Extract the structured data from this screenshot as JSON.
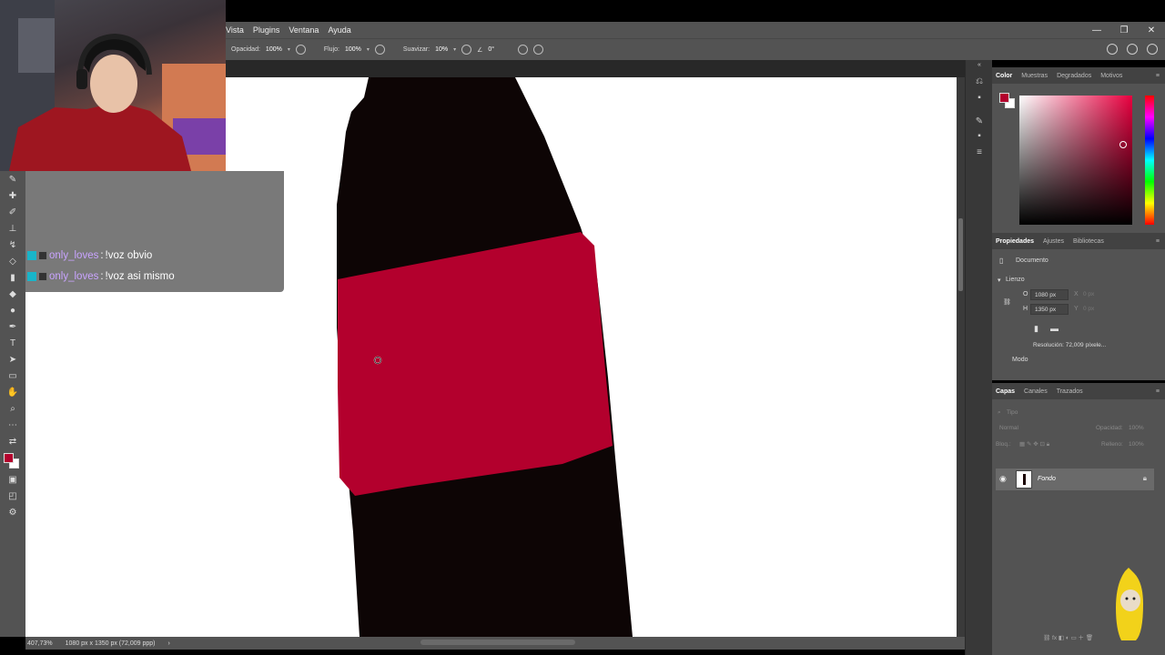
{
  "menu": {
    "items": [
      "Vista",
      "Plugins",
      "Ventana",
      "Ayuda"
    ]
  },
  "options": {
    "opacity_label": "Opacidad:",
    "opacity_value": "100%",
    "flow_label": "Flujo:",
    "flow_value": "100%",
    "smooth_label": "Suavizar:",
    "smooth_value": "10%",
    "angle_value": "0°"
  },
  "status": {
    "zoom": "407,73%",
    "doc_info": "1080 px x 1350 px (72,009 ppp)"
  },
  "color_panel": {
    "tabs": [
      "Color",
      "Muestras",
      "Degradados",
      "Motivos"
    ],
    "foreground": "#b3002d",
    "background": "#ffffff"
  },
  "properties_panel": {
    "tabs": [
      "Propiedades",
      "Ajustes",
      "Bibliotecas"
    ],
    "doc_label": "Documento",
    "section": "Lienzo",
    "width_label": "O",
    "width_value": "1080 px",
    "height_label": "H",
    "height_value": "1350 px",
    "x_label": "X",
    "x_value": "0 px",
    "y_label": "Y",
    "y_value": "0 px",
    "resolution": "Resolución: 72,009 píxele...",
    "mode_label": "Modo"
  },
  "layers_panel": {
    "tabs": [
      "Capas",
      "Canales",
      "Trazados"
    ],
    "search_placeholder": "Tipo",
    "blend_mode": "Normal",
    "opacity_label": "Opacidad:",
    "opacity_value": "100%",
    "lock_label": "Bloq.:",
    "fill_label": "Relleno:",
    "fill_value": "100%",
    "layer_name": "Fondo"
  },
  "chat": {
    "messages": [
      {
        "user": "only_loves",
        "separator": ":",
        "text": "!voz obvio"
      },
      {
        "user": "only_loves",
        "separator": ":",
        "text": "!voz asi mismo"
      }
    ]
  },
  "colors": {
    "bottle_black": "#0d0505",
    "label_red": "#b3002d",
    "ui_panel": "#535353"
  }
}
